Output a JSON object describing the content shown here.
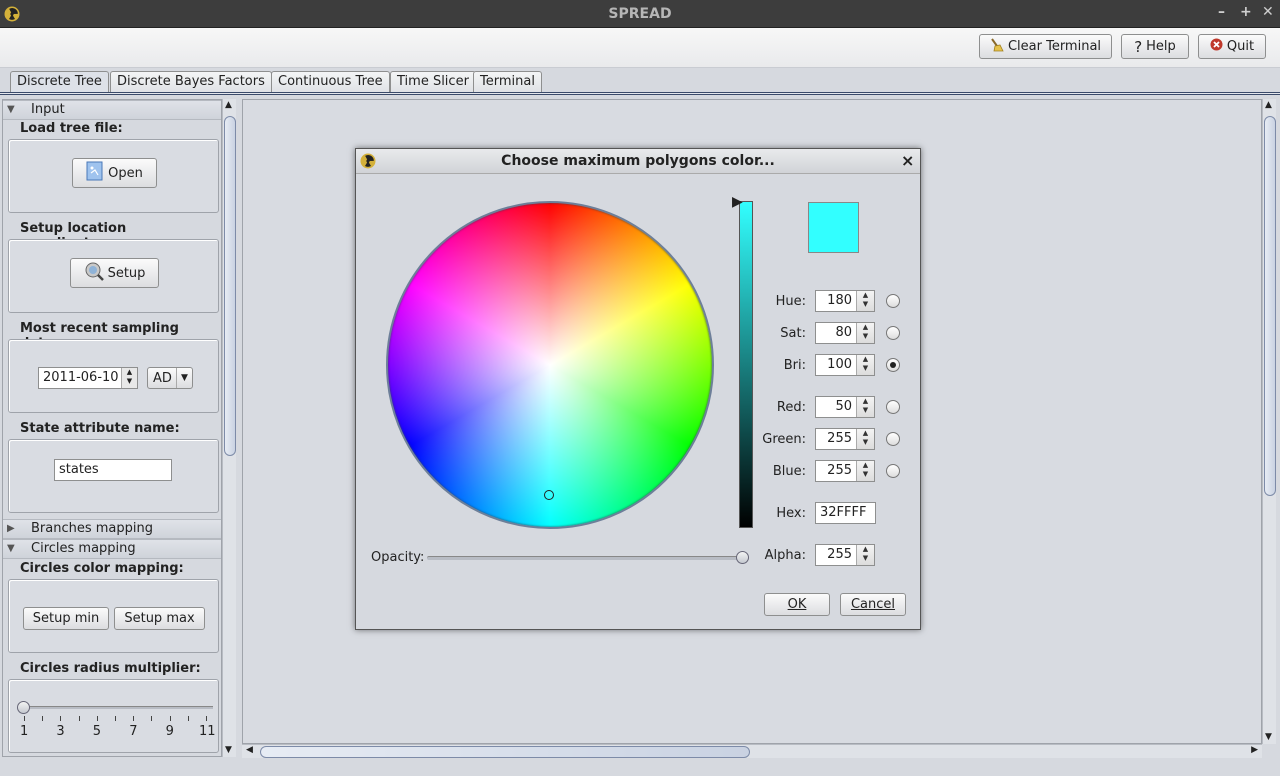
{
  "window": {
    "title": "SPREAD",
    "controls": [
      "–",
      "+",
      "✕"
    ]
  },
  "toolbar": {
    "clear_terminal": "Clear Terminal",
    "help": "Help",
    "quit": "Quit"
  },
  "tabs": [
    "Discrete Tree",
    "Discrete Bayes Factors",
    "Continuous Tree",
    "Time Slicer",
    "Terminal"
  ],
  "left": {
    "input_header": "Input",
    "load_tree_label": "Load tree file:",
    "open_button": "Open",
    "setup_coords_label": "Setup location coordinates:",
    "setup_button": "Setup",
    "sampling_date_label": "Most recent sampling date:",
    "date_value": "2011-06-10",
    "era_value": "AD",
    "state_attr_label": "State attribute name:",
    "state_attr_value": "states",
    "branches_header": "Branches mapping",
    "circles_header": "Circles mapping",
    "circles_color_label": "Circles color mapping:",
    "setup_min": "Setup min",
    "setup_max": "Setup max",
    "radius_label": "Circles radius multiplier:",
    "radius_ticks": [
      "1",
      "3",
      "5",
      "7",
      "9",
      "11"
    ],
    "radius_value": 1
  },
  "dialog": {
    "title": "Choose maximum polygons color...",
    "close": "×",
    "preview_color": "#32FFFF",
    "fields": {
      "hue_label": "Hue:",
      "hue": "180",
      "sat_label": "Sat:",
      "sat": "80",
      "bri_label": "Bri:",
      "bri": "100",
      "red_label": "Red:",
      "red": "50",
      "green_label": "Green:",
      "green": "255",
      "blue_label": "Blue:",
      "blue": "255",
      "hex_label": "Hex:",
      "hex": "32FFFF",
      "alpha_label": "Alpha:",
      "alpha": "255"
    },
    "selected_mode": "Bri",
    "opacity_label": "Opacity:",
    "opacity_value": 1.0,
    "ok": "OK",
    "cancel": "Cancel"
  },
  "colors": {
    "accent": "#3a4a6a",
    "quit_icon": "#c0392b"
  }
}
